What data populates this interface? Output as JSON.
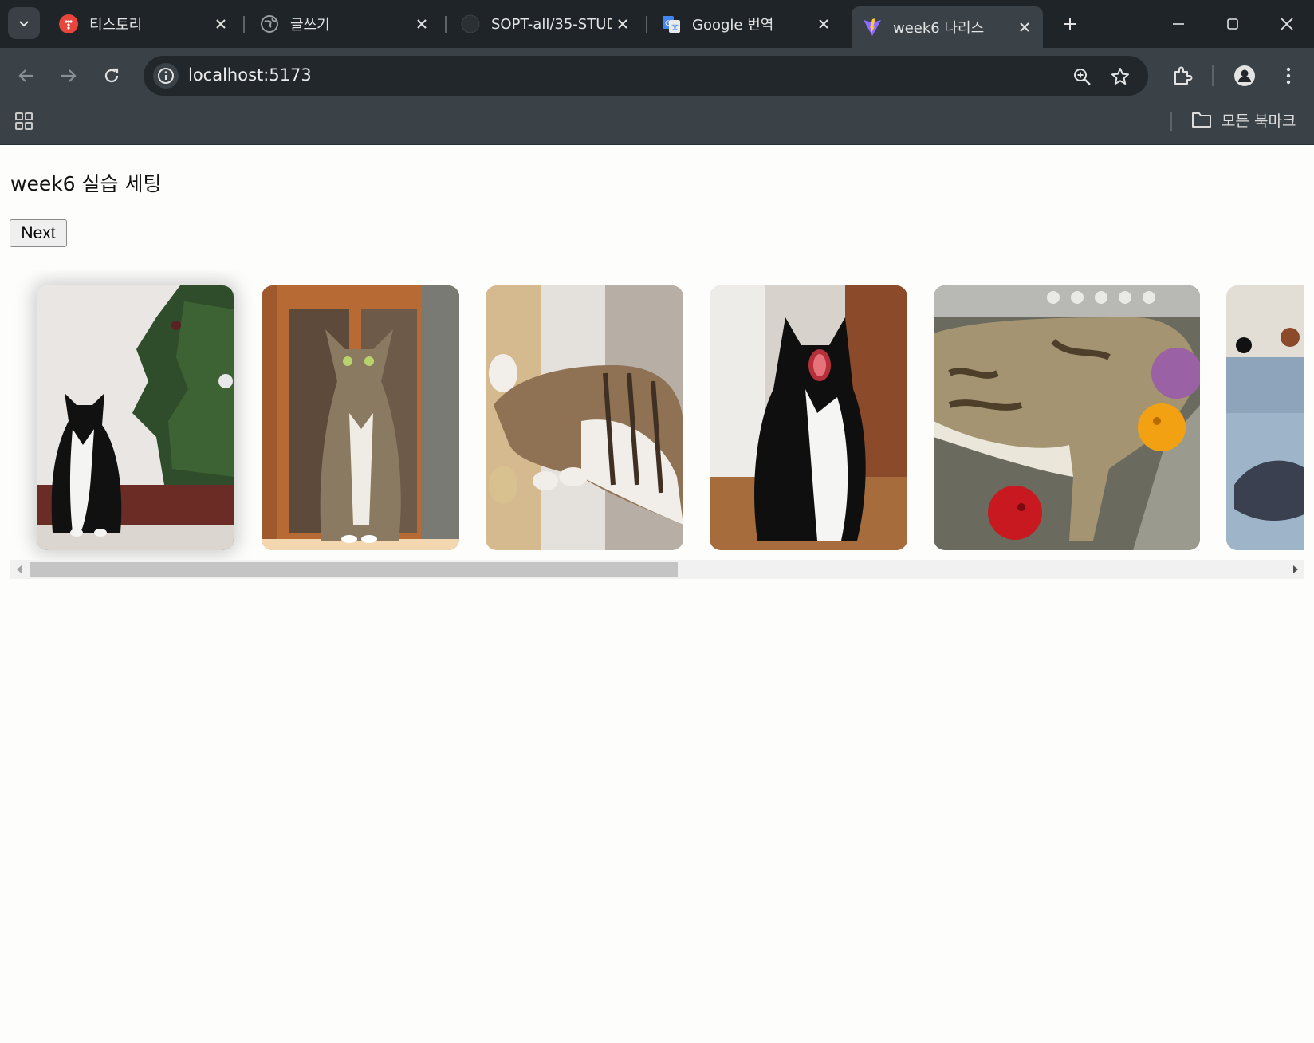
{
  "browser": {
    "tabs": [
      {
        "title": "티스토리",
        "icon": "tistory-icon",
        "active": false
      },
      {
        "title": "글쓰기",
        "icon": "globe-icon",
        "active": false
      },
      {
        "title": "SOPT-all/35-STUD",
        "icon": "github-icon",
        "active": false
      },
      {
        "title": "Google 번역",
        "icon": "google-translate-icon",
        "active": false
      },
      {
        "title": "week6 나리스",
        "icon": "vite-icon",
        "active": true
      }
    ],
    "url": "localhost:5173",
    "bookmarks_label": "모든 북마크"
  },
  "page": {
    "title": "week6 실습 세팅",
    "next_label": "Next"
  },
  "gallery": {
    "images": [
      {
        "alt": "black and white cat sitting by a christmas tree",
        "selected": true
      },
      {
        "alt": "tabby cat sitting in front of a wooden door",
        "selected": false
      },
      {
        "alt": "tabby cat sleeping on a cat tower",
        "selected": false
      },
      {
        "alt": "black and white cat yawning",
        "selected": false
      },
      {
        "alt": "tabby kitten sleeping with toy balls",
        "selected": false
      },
      {
        "alt": "cat on a blue sofa",
        "selected": false
      }
    ],
    "scroll_position": 0.0,
    "scroll_visible_fraction": 0.5
  },
  "colors": {
    "chrome_dark": "#1f2428",
    "chrome_toolbar": "#3a4247",
    "page_bg": "#fdfdfc"
  }
}
